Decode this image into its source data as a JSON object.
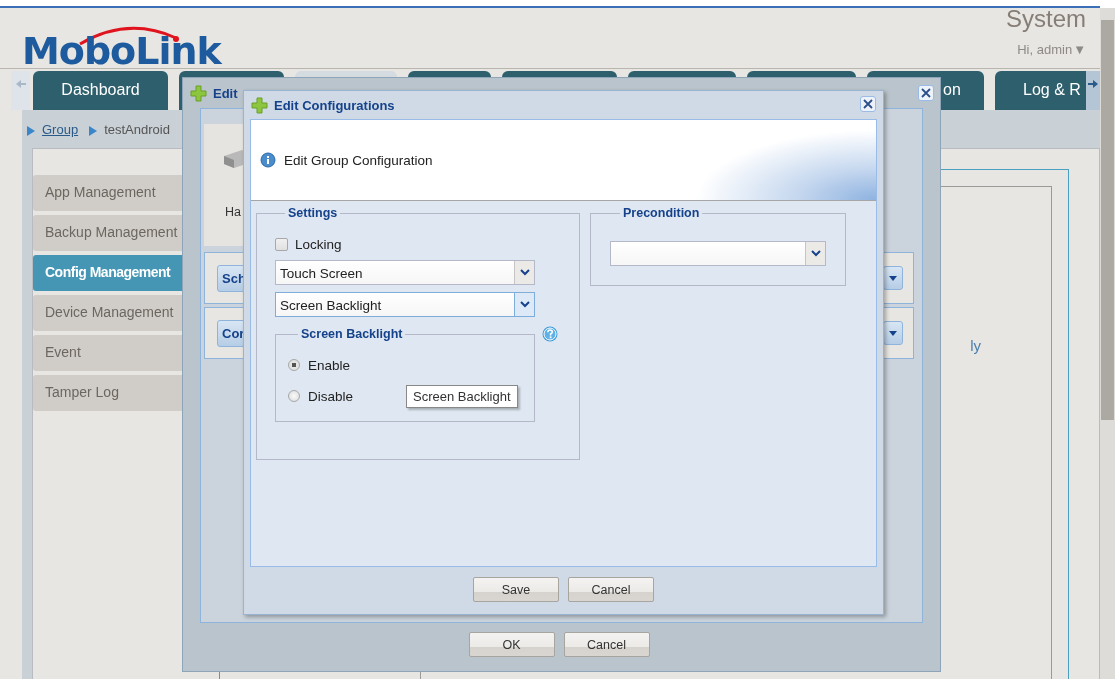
{
  "header": {
    "logo": "MoboLink",
    "system_title": "System",
    "user_menu": "Hi, admin",
    "user_caret": "▼"
  },
  "tabs": [
    {
      "label": "Dashboard",
      "selected": false
    },
    {
      "selected": false
    },
    {
      "selected": true
    },
    {
      "selected": false
    },
    {
      "selected": false
    },
    {
      "selected": false
    },
    {
      "selected": false
    },
    {
      "label": "on",
      "selected": false
    },
    {
      "label": "Log & R",
      "selected": false
    }
  ],
  "breadcrumb": [
    {
      "label": "Group",
      "kind": "link"
    },
    {
      "label": "testAndroid",
      "kind": "text"
    }
  ],
  "sidebar": {
    "items": [
      {
        "label": "App Management",
        "selected": false
      },
      {
        "label": "Backup Management",
        "selected": false
      },
      {
        "label": "Config Management",
        "selected": true
      },
      {
        "label": "Device Management",
        "selected": false
      },
      {
        "label": "Event",
        "selected": false
      },
      {
        "label": "Tamper Log",
        "selected": false
      }
    ]
  },
  "content": {
    "text": "ly"
  },
  "outer_dialog": {
    "title": "Edit",
    "card_label": "Ha",
    "row_buttons": [
      "Sch",
      "Cor"
    ],
    "buttons": [
      "OK",
      "Cancel"
    ]
  },
  "dialog": {
    "title": "Edit Configurations",
    "banner": "Edit Group Configuration",
    "settings": {
      "legend": "Settings",
      "locking": {
        "label": "Locking",
        "checked": false
      },
      "selects": [
        {
          "value": "Touch Screen",
          "focused": false
        },
        {
          "value": "Screen Backlight",
          "focused": true
        }
      ],
      "backlight": {
        "legend": "Screen Backlight",
        "options": [
          {
            "label": "Enable",
            "selected": true
          },
          {
            "label": "Disable",
            "selected": false
          }
        ]
      }
    },
    "tooltip": "Screen Backlight",
    "precondition": {
      "legend": "Precondition",
      "select": {
        "focused": false
      }
    },
    "buttons": [
      "Save",
      "Cancel"
    ]
  }
}
